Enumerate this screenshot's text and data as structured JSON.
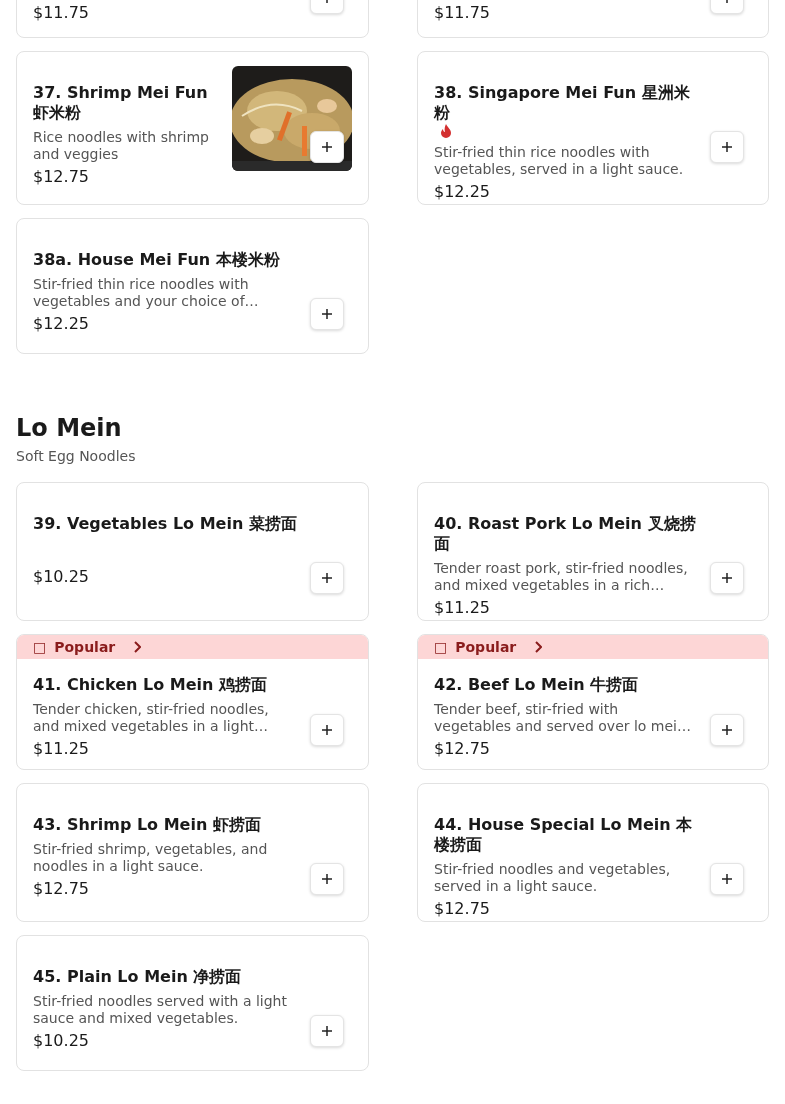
{
  "top_items": [
    {
      "price": "$11.75"
    },
    {
      "price": "$11.75"
    }
  ],
  "items": [
    {
      "name": "37. Shrimp Mei Fun 虾米粉",
      "description": "Rice noodles with shrimp and veggies",
      "price": "$12.75",
      "spicy": false,
      "popular": false
    },
    {
      "name": "38. Singapore Mei Fun 星洲米粉",
      "description": "Stir-fried thin rice noodles with vegetables, served in a light sauce.",
      "price": "$12.25",
      "spicy": true,
      "popular": false
    },
    {
      "name": "38a. House Mei Fun 本楼米粉",
      "description": "Stir-fried thin rice noodles with vegetables and your choice of…",
      "price": "$12.25",
      "spicy": false,
      "popular": false
    }
  ],
  "section": {
    "title": "Lo Mein",
    "subtitle": "Soft Egg Noodles"
  },
  "section_items": [
    {
      "name": "39. Vegetables Lo Mein 菜捞面",
      "price": "$10.25",
      "spicy": false,
      "popular": false
    },
    {
      "name": "40. Roast Pork Lo Mein 叉烧捞面",
      "description": "Tender roast pork, stir-fried noodles, and mixed vegetables in a rich…",
      "price": "$11.25",
      "spicy": false,
      "popular": false
    },
    {
      "name": "41. Chicken Lo Mein 鸡捞面",
      "description": "Tender chicken, stir-fried noodles, and mixed vegetables in a light…",
      "price": "$11.25",
      "spicy": false,
      "popular": true,
      "badge_icon": "□",
      "badge": "Popular"
    },
    {
      "name": "42. Beef Lo Mein 牛捞面",
      "description": "Tender beef, stir-fried with vegetables and served over lo mei…",
      "price": "$12.75",
      "spicy": false,
      "popular": true,
      "badge_icon": "□",
      "badge": "Popular"
    },
    {
      "name": "43. Shrimp Lo Mein 虾捞面",
      "description": "Stir-fried shrimp, vegetables, and noodles in a light sauce.",
      "price": "$12.75",
      "spicy": false,
      "popular": false
    },
    {
      "name": "44. House Special Lo Mein 本楼捞面",
      "description": "Stir-fried noodles and vegetables, served in a light sauce.",
      "price": "$12.75",
      "spicy": false,
      "popular": false
    },
    {
      "name": "45. Plain Lo Mein 净捞面",
      "description": "Stir-fried noodles served with a light sauce and mixed vegetables.",
      "price": "$10.25",
      "spicy": false,
      "popular": false
    }
  ]
}
